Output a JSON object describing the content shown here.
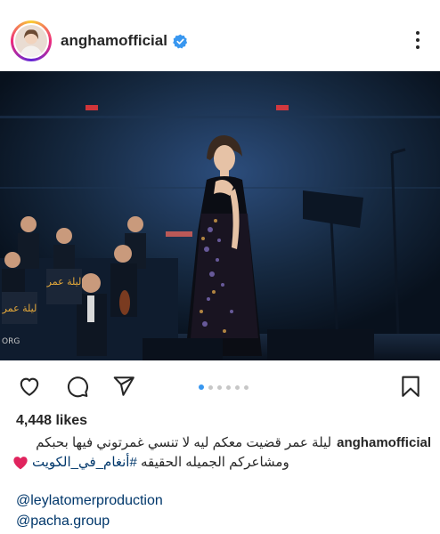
{
  "post": {
    "username": "anghamofficial",
    "verified_icon": "verified-badge-icon",
    "more_icon": "more-options-icon"
  },
  "photo": {
    "sign_text": "ليلة عمر",
    "logo_text": "ORG"
  },
  "actions": {
    "like_icon": "heart-outline-icon",
    "comment_icon": "comment-bubble-icon",
    "share_icon": "paper-plane-icon",
    "save_icon": "bookmark-icon",
    "carousel_total": 6,
    "carousel_active": 1
  },
  "likes": "4,448 likes",
  "caption": {
    "username": "anghamofficial",
    "line1": "ليلة عمر  قضيت معكم ليه لا تنسي غمرتوني  فيها بحبكم",
    "line2_text": "ومشاعركم الجميله الحقيقه ",
    "hashtag": "#أنغام_في_الكويت"
  },
  "mentions": [
    "@leylatomerproduction",
    "@pacha.group"
  ],
  "colors": {
    "link": "#00376b",
    "accent_blue": "#3897f0",
    "heart_red": "#e0245e",
    "text": "#262626"
  }
}
